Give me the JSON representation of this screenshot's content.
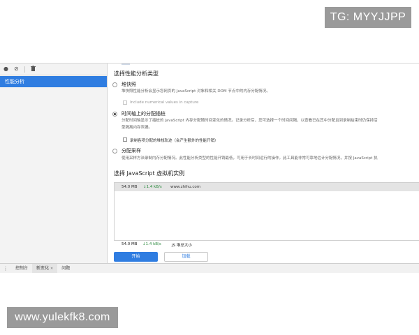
{
  "watermarks": {
    "top": "TG: MYYJJPP",
    "bottom": "www.yulekfk8.com"
  },
  "toolbar": {
    "record_icon": "record-icon",
    "clear_icon": "clear-icon",
    "trash_icon": "trash-icon"
  },
  "sidebar": {
    "items": [
      {
        "label": "性能分析"
      }
    ]
  },
  "main": {
    "type_title": "选择性能分析类型",
    "options": [
      {
        "label": "堆快照",
        "description": "堆快照性能分析会显示您网页的 JavaScript 对象和相关 DOM 节点中的内存分配情况。",
        "checked": false,
        "checkbox": {
          "label": "Include numerical values in capture",
          "checked": false,
          "disabled": true
        }
      },
      {
        "label": "时间轴上的分配插桩",
        "description_line1": "分配时间轴显示了插桩的 JavaScript 内存分配随时间变化的情况。记录分析后，您可选择一个时间间隔，以查看已在其中分配且到录制结束时仍保持活",
        "description_line2": "型隔离内存泄漏。",
        "checked": true,
        "checkbox": {
          "label": "录制各项分配的堆栈轨迹（会产生额外的性能开销）",
          "checked": false,
          "disabled": false
        }
      },
      {
        "label": "分配采样",
        "description": "使用采样方法录制内存分配情况。此性能分析类型的性能开销最低，可用于长时间运行的操作。此工具能非常可靠地估计分配情况，并按 JavaScript 执",
        "checked": false
      }
    ],
    "vm_title": "选择 JavaScript 虚拟机实例",
    "vm_rows": [
      {
        "size": "54.0 MB",
        "rate": "↓1.4 kB/s",
        "url": "www.zhihu.com"
      }
    ],
    "footer": {
      "size": "54.0 MB",
      "rate": "↓1.4 kB/s",
      "label": "JS 堆总大小"
    },
    "buttons": {
      "start": "开始",
      "load": "加载"
    }
  },
  "drawer": {
    "tabs": [
      {
        "label": "控制台",
        "active": false
      },
      {
        "label": "新变化",
        "active": true,
        "closable": true
      },
      {
        "label": "问题",
        "active": false
      }
    ]
  },
  "colors": {
    "accent": "#2f7de1",
    "rate_green": "#2b8a3e"
  }
}
